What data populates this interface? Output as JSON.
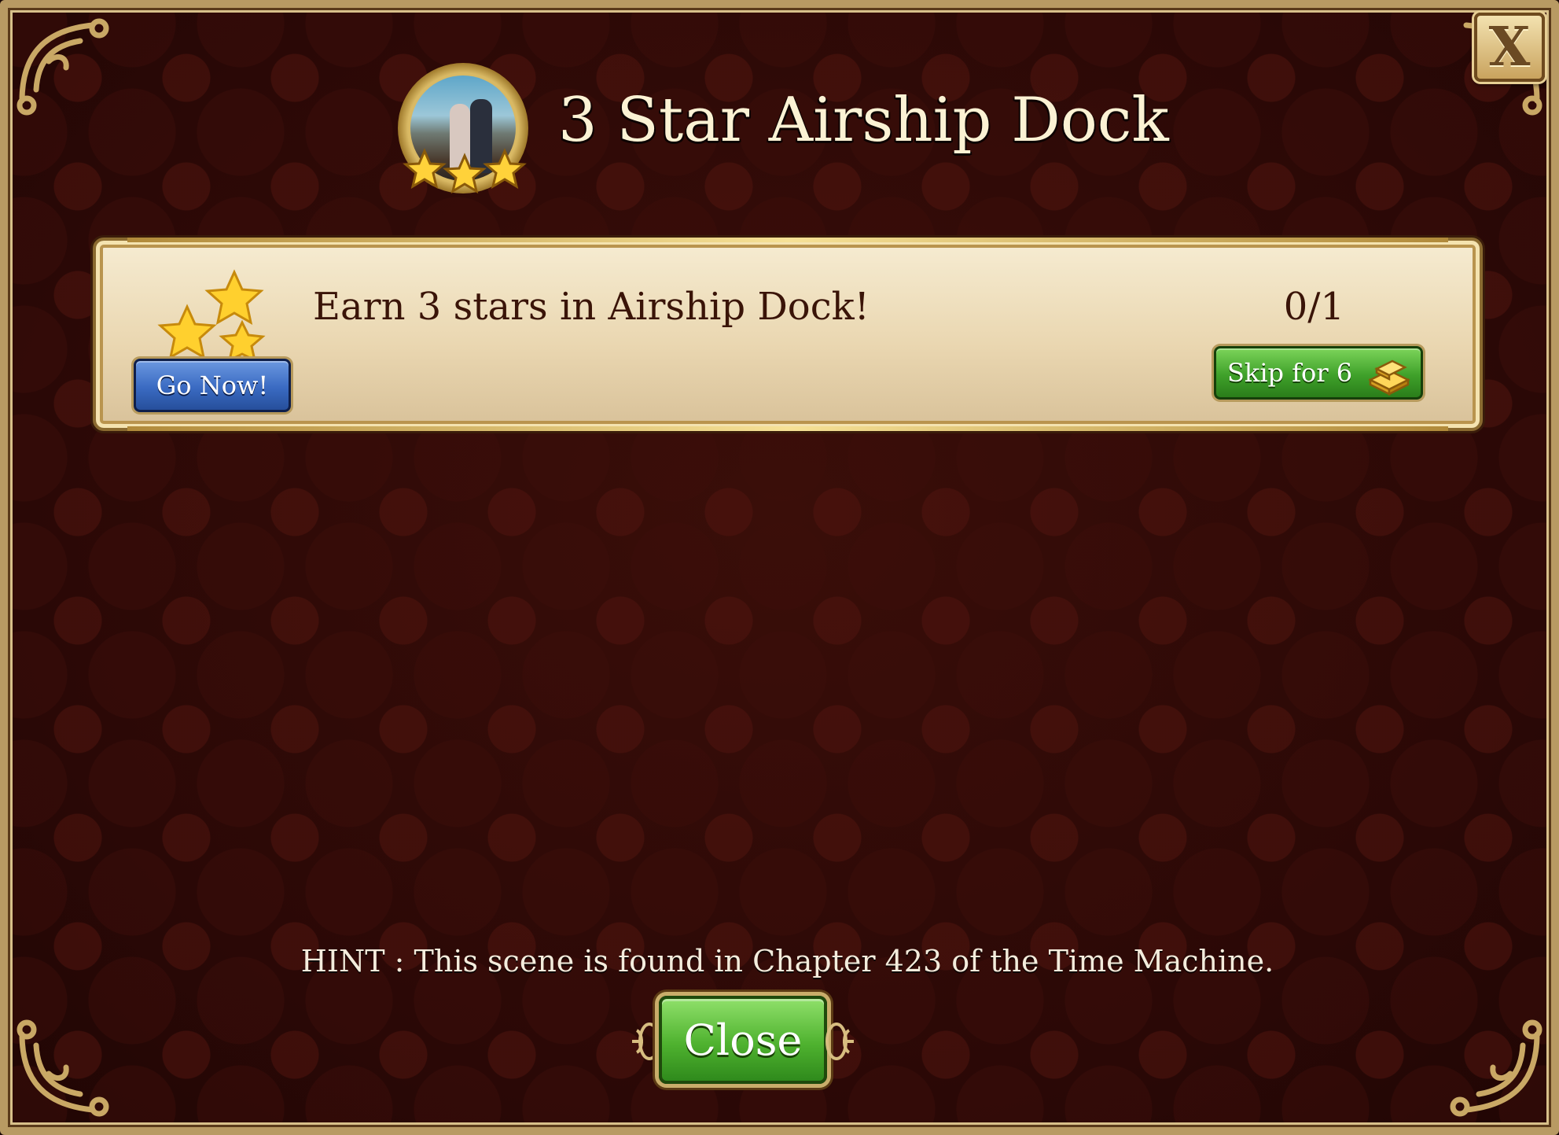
{
  "dialog": {
    "title": "3 Star Airship Dock",
    "close_icon_label": "X"
  },
  "task": {
    "description": "Earn 3 stars in Airship Dock!",
    "progress": "0/1",
    "go_now_label": "Go Now!",
    "skip_label": "Skip for 6"
  },
  "hint": "HINT : This scene is found in Chapter 423 of the Time Machine.",
  "footer": {
    "close_label": "Close"
  },
  "icons": {
    "badge": "airship-dock-scene-badge-icon",
    "badge_stars": "three-stars-icon",
    "task_stars": "stars-icon",
    "currency": "gold-bars-icon",
    "close": "close-icon"
  },
  "colors": {
    "background": "#2e0a07",
    "panel": "#ead7b1",
    "go_now": "#3a6ac2",
    "skip": "#3fa12a",
    "close_button": "#4fb22f",
    "title_text": "#fbf2d4"
  }
}
